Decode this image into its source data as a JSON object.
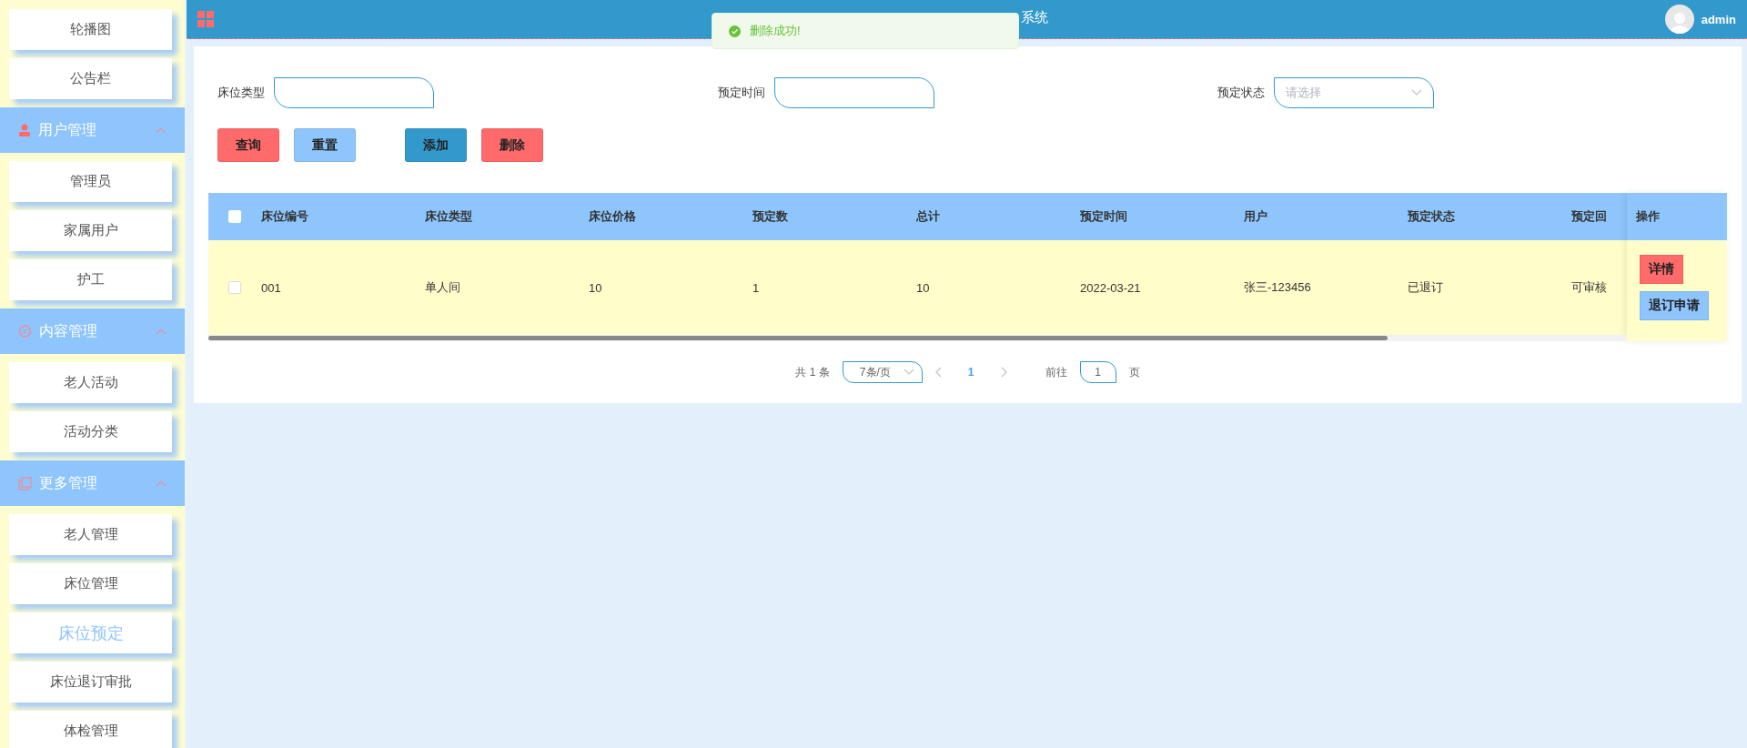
{
  "header": {
    "title": "系统",
    "user": "admin"
  },
  "toast": {
    "message": "删除成功!"
  },
  "sidebar": [
    {
      "kind": "item",
      "label": "轮播图",
      "selected": false
    },
    {
      "kind": "item",
      "label": "公告栏",
      "selected": false
    },
    {
      "kind": "group",
      "label": "用户管理",
      "expanded": true
    },
    {
      "kind": "item",
      "label": "管理员",
      "selected": false
    },
    {
      "kind": "item",
      "label": "家属用户",
      "selected": false
    },
    {
      "kind": "item",
      "label": "护工",
      "selected": false
    },
    {
      "kind": "group",
      "label": "内容管理",
      "expanded": true
    },
    {
      "kind": "item",
      "label": "老人活动",
      "selected": false
    },
    {
      "kind": "item",
      "label": "活动分类",
      "selected": false
    },
    {
      "kind": "group",
      "label": "更多管理",
      "expanded": true
    },
    {
      "kind": "item",
      "label": "老人管理",
      "selected": false
    },
    {
      "kind": "item",
      "label": "床位管理",
      "selected": false
    },
    {
      "kind": "item",
      "label": "床位预定",
      "selected": true
    },
    {
      "kind": "item",
      "label": "床位退订审批",
      "selected": false
    },
    {
      "kind": "item",
      "label": "体检管理",
      "selected": false
    }
  ],
  "filters": [
    {
      "kind": "input",
      "label": "床位类型"
    },
    {
      "kind": "input",
      "label": "预定时间"
    },
    {
      "kind": "select",
      "label": "预定状态",
      "placeholder": "请选择"
    }
  ],
  "buttons": [
    {
      "label": "查询",
      "kind": "danger"
    },
    {
      "label": "重置",
      "kind": "light"
    },
    {
      "label": "添加",
      "kind": "primary"
    },
    {
      "label": "删除",
      "kind": "danger"
    }
  ],
  "table": {
    "columns": [
      "床位编号",
      "床位类型",
      "床位价格",
      "预定数",
      "总计",
      "预定时间",
      "用户",
      "预定状态",
      "预定回"
    ],
    "header_checked": false,
    "actions_column": "操作",
    "rows": [
      {
        "checked": false,
        "cells": [
          "001",
          "单人间",
          "10",
          "1",
          "10",
          "2022-03-21",
          "张三-123456",
          "已退订",
          "可审核"
        ],
        "actions": [
          {
            "label": "详情",
            "kind": "danger"
          },
          {
            "label": "退订申请",
            "kind": "light"
          }
        ]
      }
    ]
  },
  "pagination": {
    "total": "共 1 条",
    "page_size": "7条/页",
    "pages": [
      {
        "label": "1",
        "selected": true
      }
    ],
    "goto_label": "前往",
    "goto_value": "1",
    "page_suffix": "页"
  }
}
